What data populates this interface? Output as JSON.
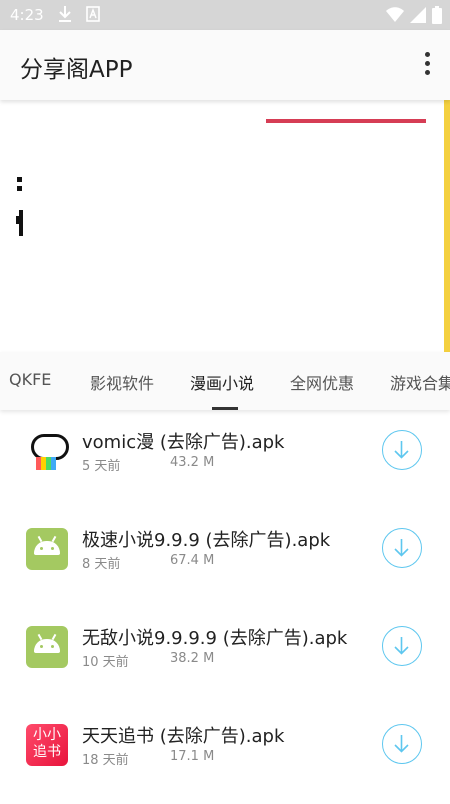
{
  "status_bar": {
    "time": "4:23",
    "icons": [
      "download-icon",
      "a-icon",
      "wifi-icon",
      "signal-icon",
      "battery-icon"
    ]
  },
  "app_bar": {
    "title": "分享阁APP",
    "menu_icon": "more-vert-icon"
  },
  "banner": {
    "accent_red": "#d63d55",
    "accent_yellow": "#f4d03f"
  },
  "tabs": [
    {
      "label": "QKFE",
      "active": false
    },
    {
      "label": "影视软件",
      "active": false
    },
    {
      "label": "漫画小说",
      "active": true
    },
    {
      "label": "全网优惠",
      "active": false
    },
    {
      "label": "游戏合集",
      "active": false
    }
  ],
  "items": [
    {
      "title": "vomic漫 (去除广告).apk",
      "date": "5 天前",
      "size": "43.2 M",
      "icon": "vomic-app-icon"
    },
    {
      "title": "极速小说9.9.9 (去除广告).apk",
      "date": "8 天前",
      "size": "67.4 M",
      "icon": "android-app-icon"
    },
    {
      "title": "无敌小说9.9.9.9 (去除广告).apk",
      "date": "10 天前",
      "size": "38.2 M",
      "icon": "android-app-icon"
    },
    {
      "title": "天天追书 (去除广告).apk",
      "date": "18 天前",
      "size": "17.1 M",
      "icon": "novel-app-icon",
      "icon_text": [
        "小小",
        "追书"
      ]
    }
  ],
  "colors": {
    "download_ring": "#5ec7ef",
    "android_green": "#a4c961",
    "novel_red": "#e8143c"
  }
}
